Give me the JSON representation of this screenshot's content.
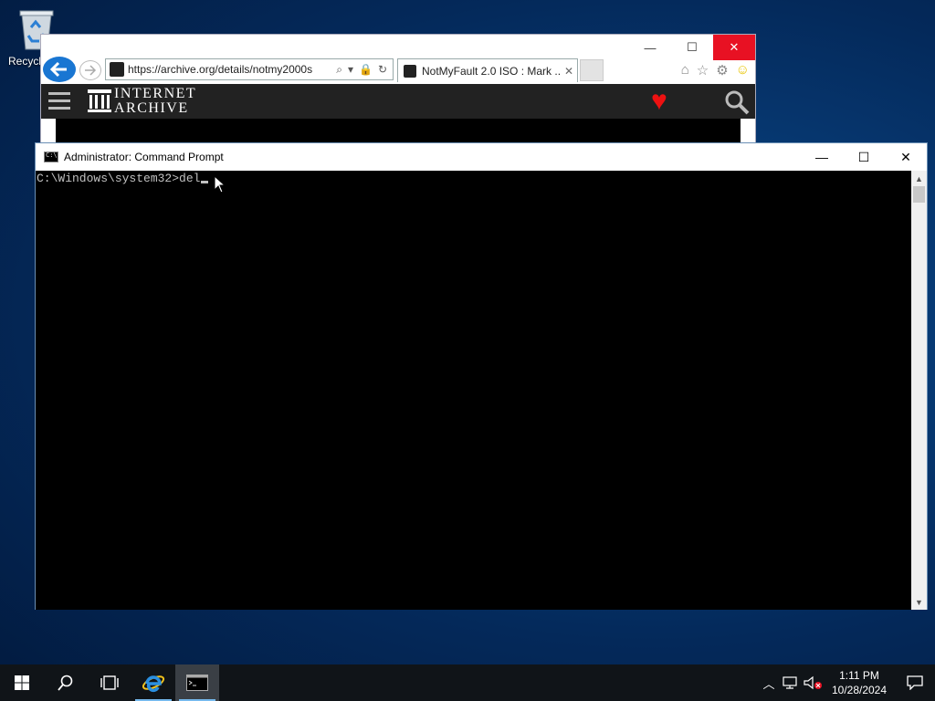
{
  "desktop": {
    "recycle_bin_label": "Recycle Bin"
  },
  "browser": {
    "url": "https://archive.org/details/notmy2000s",
    "tab_title": "NotMyFault 2.0 ISO : Mark ...",
    "tab_close": "✕",
    "minimize": "—",
    "maximize": "☐",
    "close": "✕",
    "site_name_line1": "INTERNET",
    "site_name_line2": "ARCHIVE",
    "close_color": "#e81123",
    "heart_color": "#ee1111"
  },
  "cmd": {
    "title": "Administrator: Command Prompt",
    "prompt_line": "C:\\Windows\\system32>del",
    "minimize": "—",
    "maximize": "☐",
    "close": "✕",
    "text_color": "#c0c0c0",
    "background": "#000000"
  },
  "taskbar": {
    "time": "1:11 PM",
    "date": "10/28/2024",
    "items": [
      "start-icon",
      "search-icon",
      "task-view-icon",
      "internet-explorer-icon",
      "command-prompt-icon"
    ]
  }
}
